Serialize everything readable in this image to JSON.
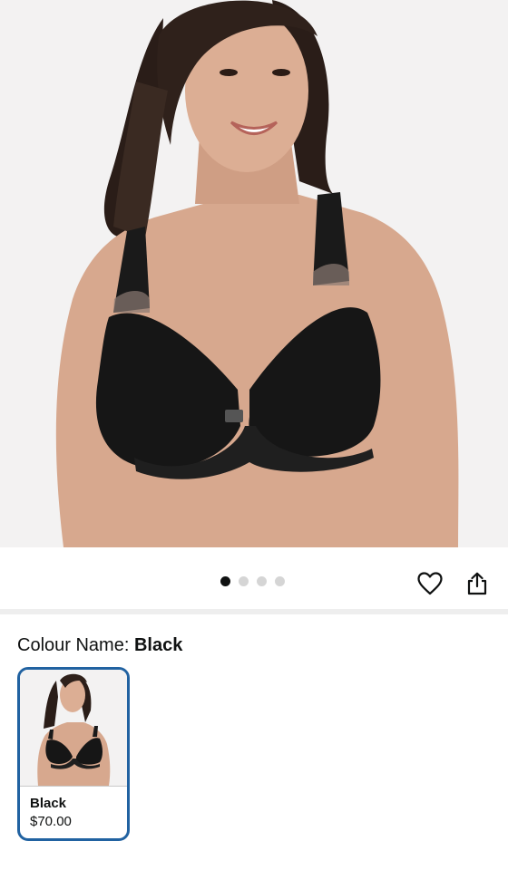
{
  "product": {
    "image_count": 4,
    "active_image_index": 0
  },
  "actions": {
    "wishlist_icon": "heart-outline-icon",
    "share_icon": "share-icon"
  },
  "colour": {
    "label": "Colour Name:",
    "selected": "Black"
  },
  "swatches": [
    {
      "name": "Black",
      "price": "$70.00"
    }
  ],
  "colors": {
    "selected_border": "#2162a1",
    "active_dot": "#0f1111",
    "inactive_dot": "#d5d5d5",
    "image_background": "#f3f2f2"
  }
}
